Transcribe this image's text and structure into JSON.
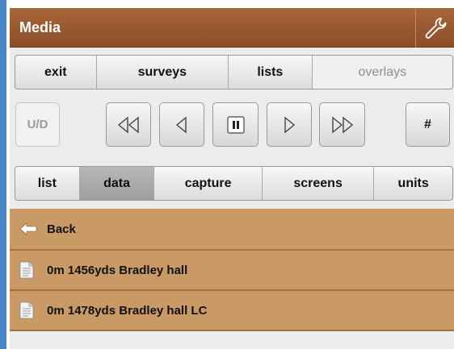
{
  "header": {
    "title": "Media",
    "settings_icon": "wrench-icon"
  },
  "nav": {
    "items": [
      "exit",
      "surveys",
      "lists",
      "overlays"
    ]
  },
  "transport": {
    "ud_label": "U/D",
    "hash_label": "#",
    "buttons": [
      "fast-rewind-icon",
      "step-back-icon",
      "pause-icon",
      "step-forward-icon",
      "fast-forward-icon"
    ]
  },
  "tabs": {
    "items": [
      "list",
      "data",
      "capture",
      "screens",
      "units"
    ],
    "active": "data"
  },
  "list": {
    "back_label": "Back",
    "files": [
      "0m 1456yds Bradley hall",
      "0m 1478yds Bradley hall LC"
    ]
  },
  "colors": {
    "header": "#8a4e28",
    "list_item": "#c99a66",
    "left_strip": "#4a86c8"
  }
}
